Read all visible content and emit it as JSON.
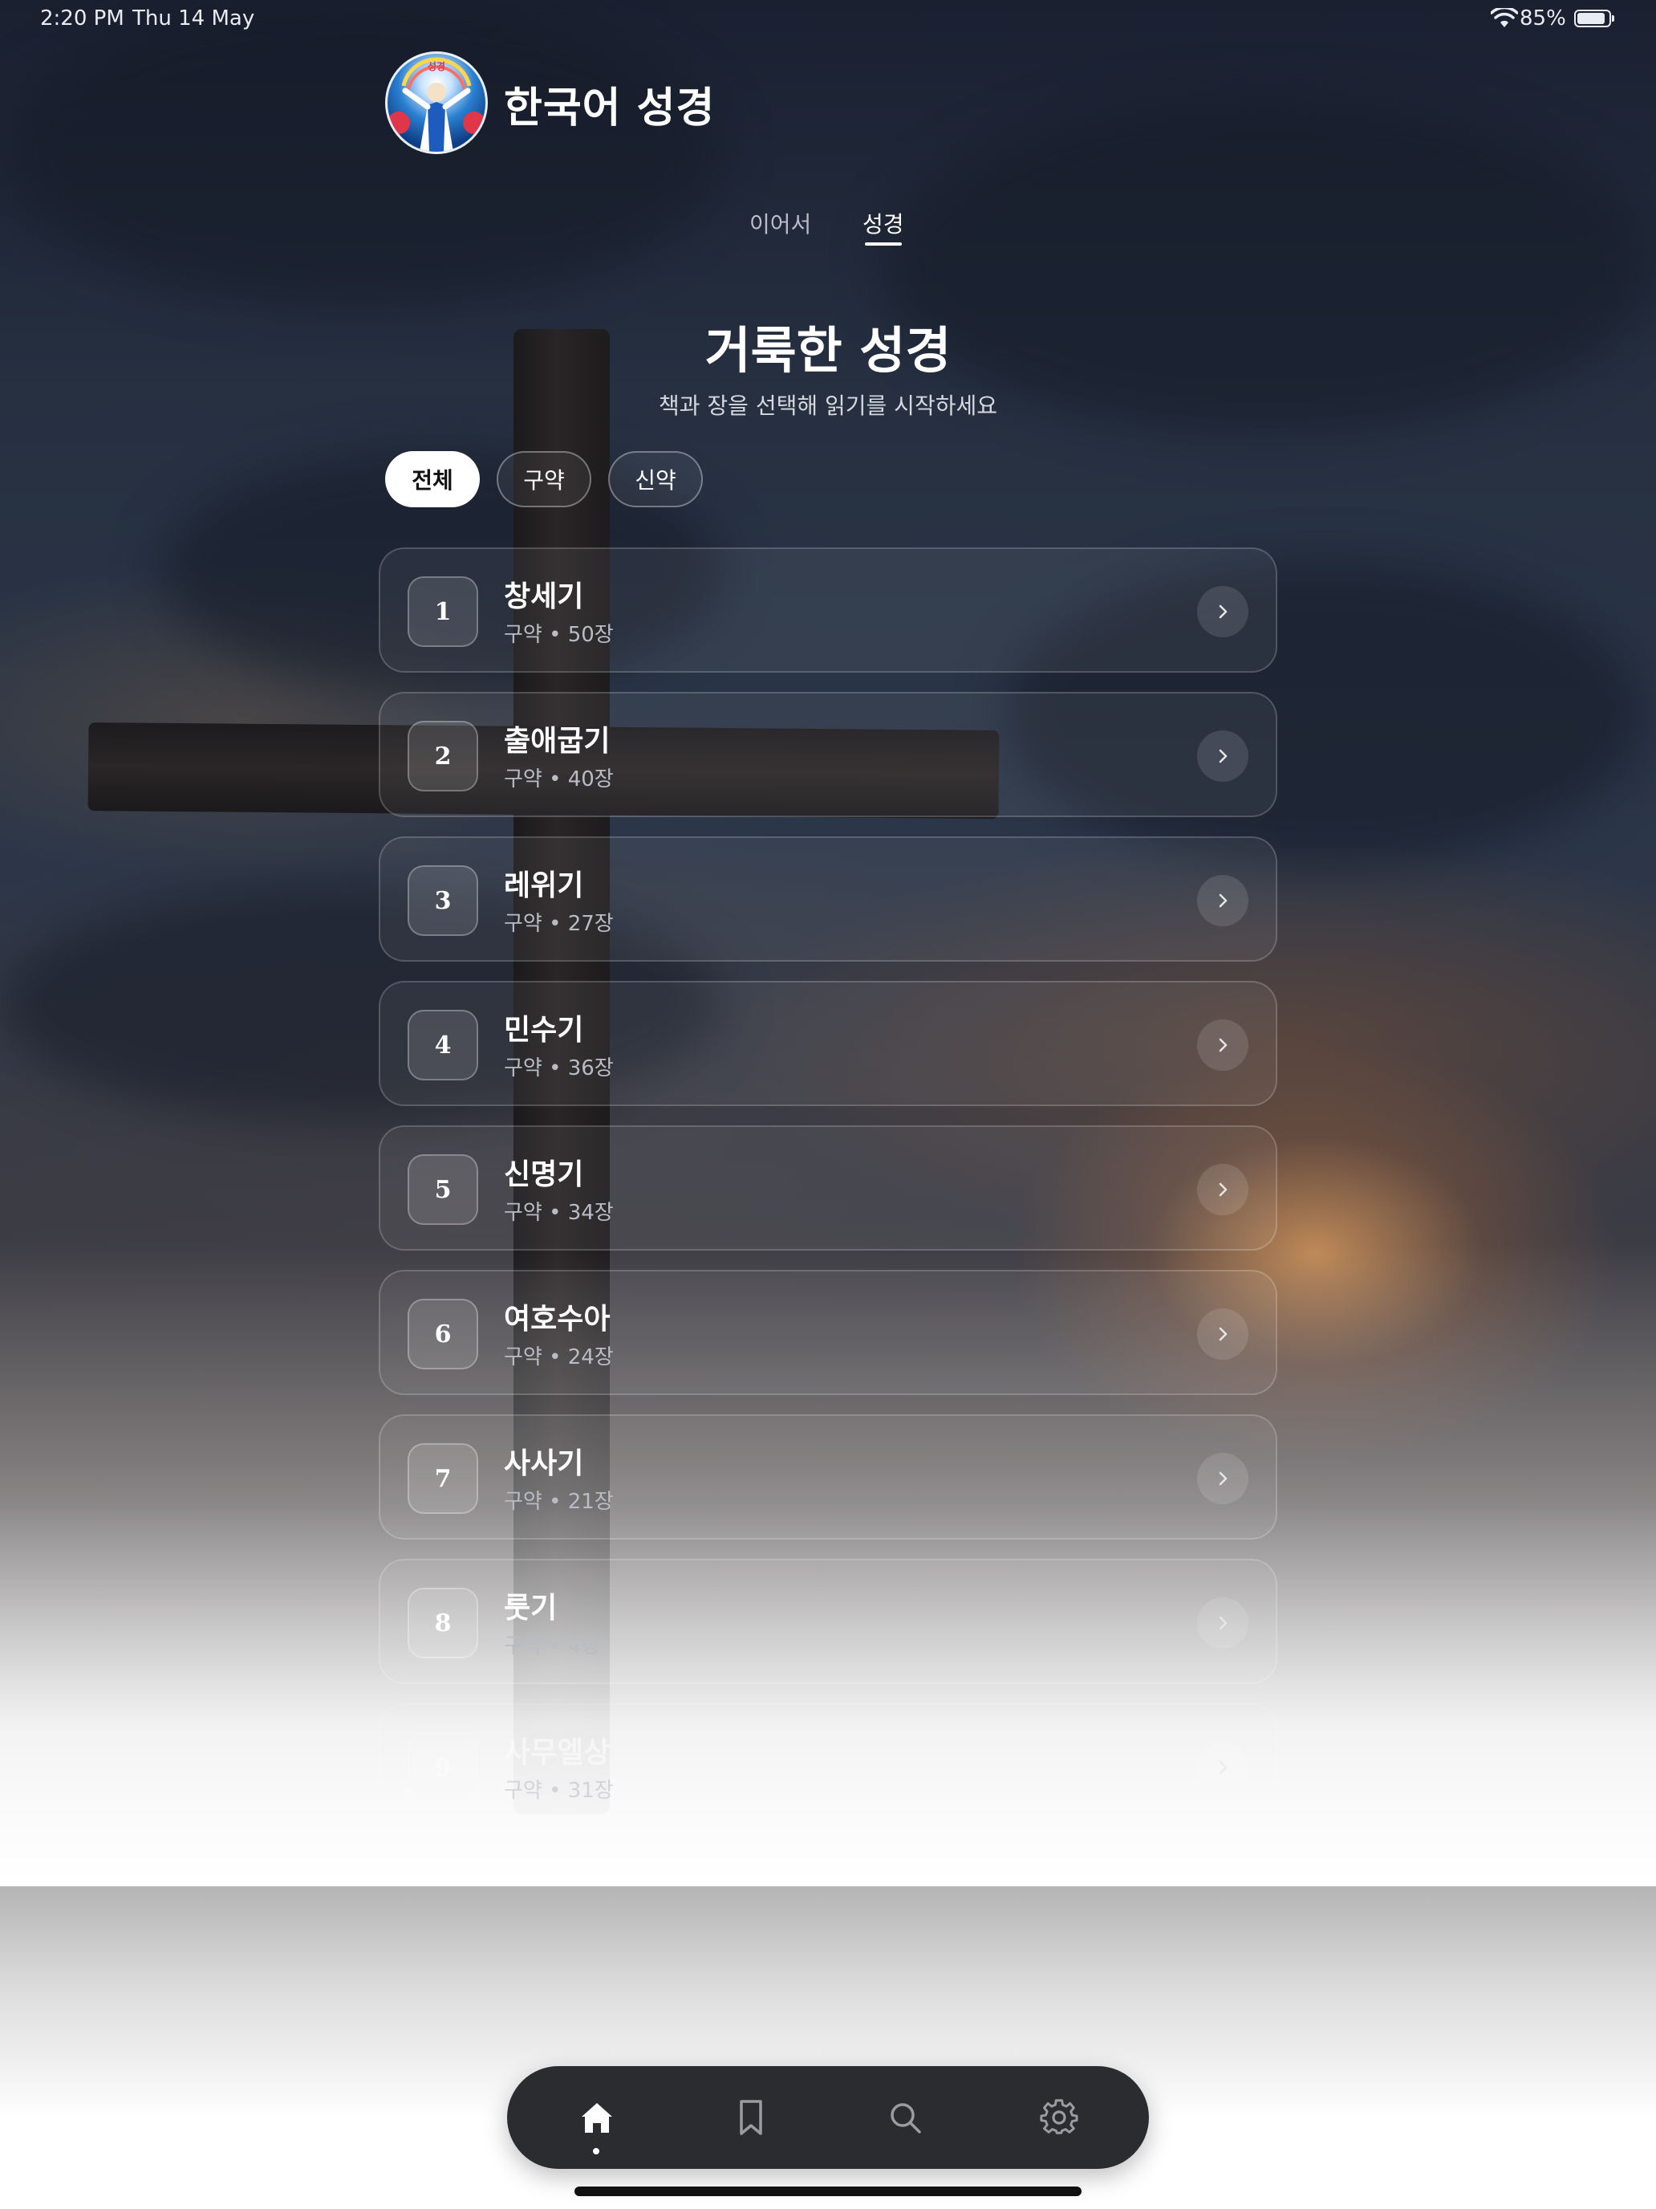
{
  "status_bar": {
    "time": "2:20 PM",
    "date": "Thu 14 May",
    "battery": "85%",
    "battery_level": 0.85
  },
  "header": {
    "title": "한국어 성경",
    "logo_text": "성경"
  },
  "tabs": [
    {
      "label": "이어서",
      "active": false
    },
    {
      "label": "성경",
      "active": true
    }
  ],
  "main": {
    "title": "거룩한 성경",
    "subtitle": "책과 장을 선택해 읽기를 시작하세요"
  },
  "filters": [
    {
      "label": "전체",
      "active": true
    },
    {
      "label": "구약",
      "active": false
    },
    {
      "label": "신약",
      "active": false
    }
  ],
  "books": [
    {
      "number": "1",
      "name": "창세기",
      "meta": "구약 • 50장"
    },
    {
      "number": "2",
      "name": "출애굽기",
      "meta": "구약 • 40장"
    },
    {
      "number": "3",
      "name": "레위기",
      "meta": "구약 • 27장"
    },
    {
      "number": "4",
      "name": "민수기",
      "meta": "구약 • 36장"
    },
    {
      "number": "5",
      "name": "신명기",
      "meta": "구약 • 34장"
    },
    {
      "number": "6",
      "name": "여호수아",
      "meta": "구약 • 24장"
    },
    {
      "number": "7",
      "name": "사사기",
      "meta": "구약 • 21장"
    },
    {
      "number": "8",
      "name": "룻기",
      "meta": "구약 • 4장"
    },
    {
      "number": "9",
      "name": "사무엘상",
      "meta": "구약 • 31장"
    }
  ],
  "tabbar": {
    "items": [
      {
        "icon": "home-icon",
        "active": true
      },
      {
        "icon": "bookmark-icon",
        "active": false
      },
      {
        "icon": "search-icon",
        "active": false
      },
      {
        "icon": "gear-icon",
        "active": false
      }
    ]
  },
  "colors": {
    "accent": "#ffffff",
    "tabbar": "#2b2c30"
  }
}
